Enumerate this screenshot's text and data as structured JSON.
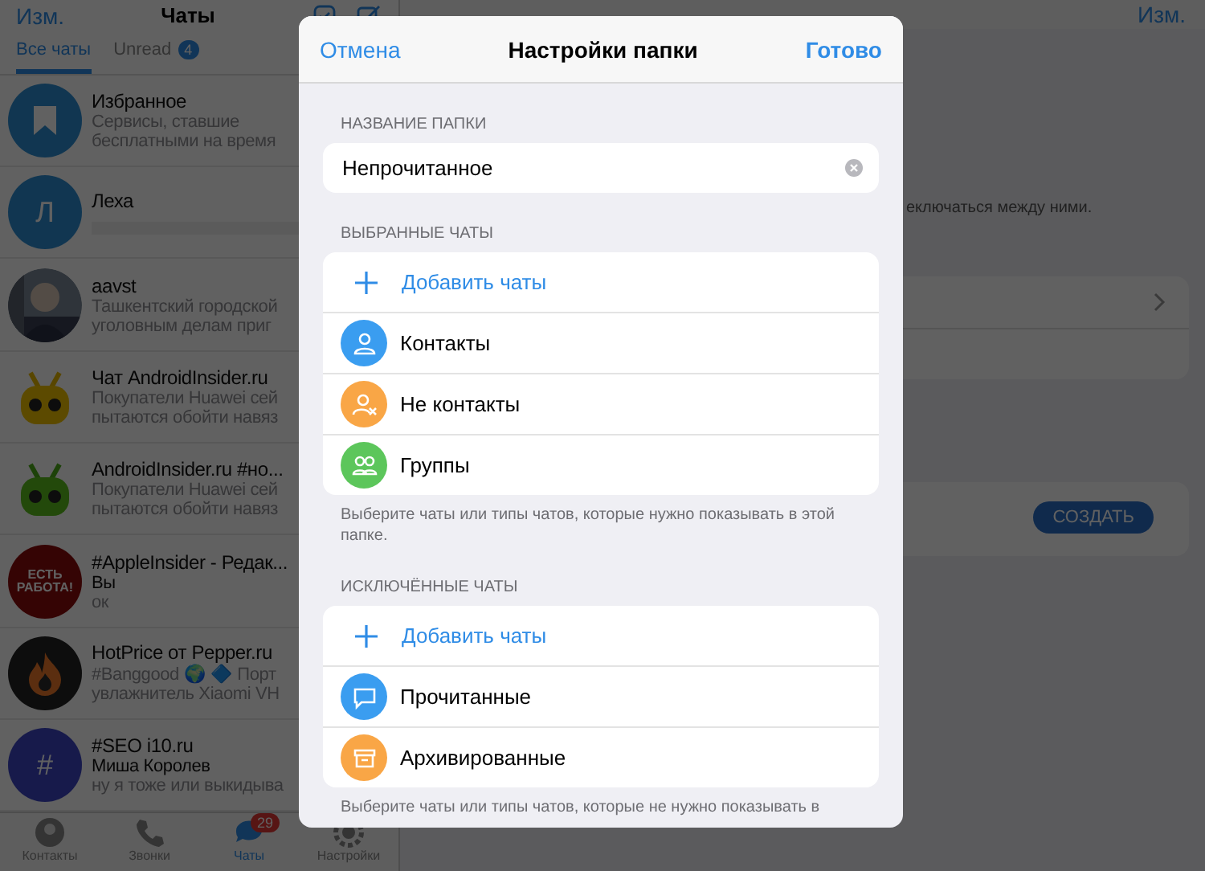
{
  "chats_panel": {
    "edit": "Изм.",
    "title": "Чаты",
    "tabs": [
      {
        "label": "Все чаты",
        "selected": true
      },
      {
        "label": "Unread",
        "badge": "4",
        "selected": false
      }
    ],
    "chats": [
      {
        "name": "Избранное",
        "lines": [
          "Сервисы, ставшие",
          "бесплатными на время"
        ],
        "kind": "bookmark"
      },
      {
        "name": "Леха",
        "redacted": true,
        "kind": "letter",
        "letter": "Л"
      },
      {
        "name": "aavst",
        "lines": [
          "Ташкентский городской",
          "уголовным делам приг"
        ],
        "kind": "picture"
      },
      {
        "name": "Чат AndroidInsider.ru",
        "lines": [
          "Покупатели Huawei сей",
          "пытаются обойти навяз"
        ],
        "kind": "yellow"
      },
      {
        "name": "AndroidInsider.ru #но...",
        "lines": [
          "Покупатели Huawei сей",
          "пытаются обойти навяз"
        ],
        "kind": "green"
      },
      {
        "name": "#AppleInsider - Редак...",
        "lines": [
          "Вы",
          "ок"
        ],
        "kind": "red",
        "letter": "ЕСТЬ РАБОТА!"
      },
      {
        "name": "HotPrice от Pepper.ru",
        "lines": [
          "#Banggood 🌍 🔷 Порт",
          "увлажнитель Xiaomi VH"
        ],
        "kind": "flame"
      },
      {
        "name": "#SEO i10.ru",
        "lines": [
          "Миша Королев",
          "ну я тоже или выкидыва"
        ],
        "kind": "hash",
        "letter": "#"
      }
    ],
    "tabbar": [
      {
        "label": "Контакты",
        "selected": false
      },
      {
        "label": "Звонки",
        "selected": false
      },
      {
        "label": "Чаты",
        "badge": "29",
        "selected": true
      },
      {
        "label": "Настройки",
        "selected": false
      }
    ]
  },
  "folders_panel": {
    "edit": "Изм.",
    "hint": "еключаться между ними.",
    "create": "СОЗДАТЬ"
  },
  "dialog": {
    "cancel": "Отмена",
    "title": "Настройки папки",
    "done": "Готово",
    "name_label": "НАЗВАНИЕ ПАПКИ",
    "name_value": "Непрочитанное",
    "sections": [
      {
        "label": "ВЫБРАННЫЕ ЧАТЫ",
        "rows": [
          {
            "kind": "add",
            "label": "Добавить чаты"
          },
          {
            "kind": "type",
            "label": "Контакты",
            "color": "#3a9df0"
          },
          {
            "kind": "type",
            "label": "Не контакты",
            "color": "#f9a646"
          },
          {
            "kind": "type",
            "label": "Группы",
            "color": "#5cc65b"
          }
        ],
        "note": "Выберите чаты или типы чатов, которые нужно показывать в этой папке."
      },
      {
        "label": "ИСКЛЮЧЁННЫЕ ЧАТЫ",
        "rows": [
          {
            "kind": "add",
            "label": "Добавить чаты"
          },
          {
            "kind": "type",
            "label": "Прочитанные",
            "color": "#3a9df0"
          },
          {
            "kind": "type",
            "label": "Архивированные",
            "color": "#f9a646"
          }
        ],
        "note": "Выберите чаты или типы чатов, которые не нужно показывать в"
      }
    ]
  }
}
